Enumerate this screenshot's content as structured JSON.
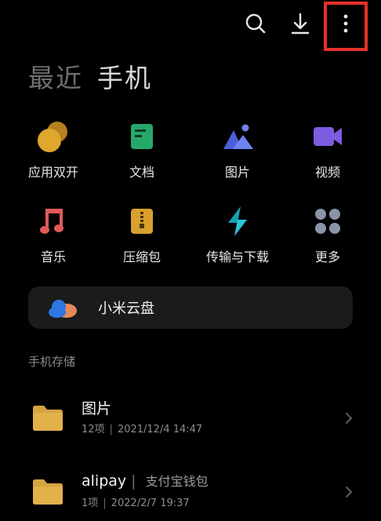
{
  "tabs": {
    "recent": "最近",
    "phone": "手机"
  },
  "categories": [
    {
      "label": "应用双开",
      "icon": "dual-app-icon",
      "color": "#e0a72e"
    },
    {
      "label": "文档",
      "icon": "document-icon",
      "color": "#27a86b"
    },
    {
      "label": "图片",
      "icon": "picture-icon",
      "color": "#5b72e8"
    },
    {
      "label": "视频",
      "icon": "video-icon",
      "color": "#7c5ce0"
    },
    {
      "label": "音乐",
      "icon": "music-icon",
      "color": "#e05a5a"
    },
    {
      "label": "压缩包",
      "icon": "archive-icon",
      "color": "#d8a02c"
    },
    {
      "label": "传输与下载",
      "icon": "transfer-icon",
      "color": "#1fa7b8"
    },
    {
      "label": "更多",
      "icon": "more-grid-icon",
      "color": "#8a93a8"
    }
  ],
  "cloud": {
    "label": "小米云盘"
  },
  "section": {
    "title": "手机存储"
  },
  "folders": [
    {
      "name": "图片",
      "alias": "",
      "count": "12项",
      "date": "2021/12/4 14:47"
    },
    {
      "name": "alipay",
      "alias": "支付宝钱包",
      "count": "1项",
      "date": "2022/2/7 19:37"
    }
  ],
  "colors": {
    "background": "#000000",
    "highlight": "#e5312a",
    "card": "#1b1b1b"
  }
}
